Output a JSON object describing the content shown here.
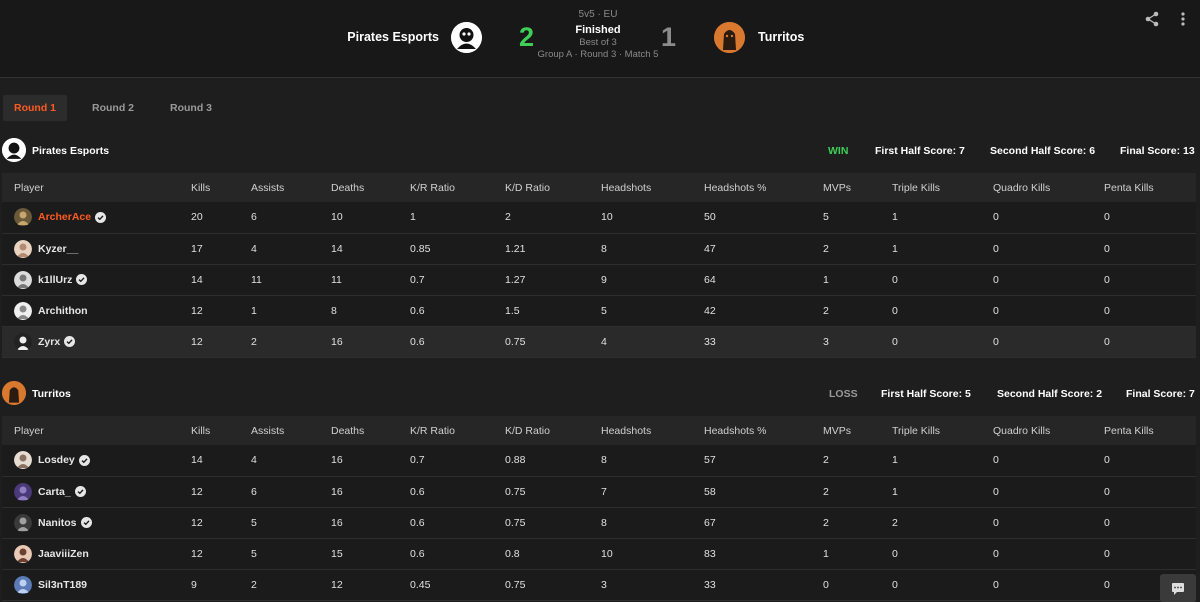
{
  "header": {
    "team_left": {
      "name": "Pirates Esports",
      "score": "2"
    },
    "team_right": {
      "name": "Turritos",
      "score": "1"
    },
    "mode": "5v5 · EU",
    "status": "Finished",
    "best_of": "Best of 3",
    "group_info": "Group A · Round 3 · Match 5"
  },
  "tabs": [
    "Round 1",
    "Round 2",
    "Round 3"
  ],
  "columns": [
    "Player",
    "Kills",
    "Assists",
    "Deaths",
    "K/R Ratio",
    "K/D Ratio",
    "Headshots",
    "Headshots %",
    "MVPs",
    "Triple Kills",
    "Quadro Kills",
    "Penta Kills"
  ],
  "team1": {
    "name": "Pirates Esports",
    "result": "WIN",
    "first_half": "First Half Score: 7",
    "second_half": "Second Half Score: 6",
    "final": "Final Score: 13",
    "players": [
      {
        "name": "ArcherAce",
        "verified": true,
        "stats": [
          "20",
          "6",
          "10",
          "1",
          "2",
          "10",
          "50",
          "5",
          "1",
          "0",
          "0"
        ]
      },
      {
        "name": "Kyzer__",
        "verified": false,
        "stats": [
          "17",
          "4",
          "14",
          "0.85",
          "1.21",
          "8",
          "47",
          "2",
          "1",
          "0",
          "0"
        ]
      },
      {
        "name": "k1llUrz",
        "verified": true,
        "stats": [
          "14",
          "11",
          "11",
          "0.7",
          "1.27",
          "9",
          "64",
          "1",
          "0",
          "0",
          "0"
        ]
      },
      {
        "name": "Archithon",
        "verified": false,
        "stats": [
          "12",
          "1",
          "8",
          "0.6",
          "1.5",
          "5",
          "42",
          "2",
          "0",
          "0",
          "0"
        ]
      },
      {
        "name": "Zyrx",
        "verified": true,
        "stats": [
          "12",
          "2",
          "16",
          "0.6",
          "0.75",
          "4",
          "33",
          "3",
          "0",
          "0",
          "0"
        ]
      }
    ]
  },
  "team2": {
    "name": "Turritos",
    "result": "LOSS",
    "first_half": "First Half Score: 5",
    "second_half": "Second Half Score: 2",
    "final": "Final Score: 7",
    "players": [
      {
        "name": "Losdey",
        "verified": true,
        "stats": [
          "14",
          "4",
          "16",
          "0.7",
          "0.88",
          "8",
          "57",
          "2",
          "1",
          "0",
          "0"
        ]
      },
      {
        "name": "Carta_",
        "verified": true,
        "stats": [
          "12",
          "6",
          "16",
          "0.6",
          "0.75",
          "7",
          "58",
          "2",
          "1",
          "0",
          "0"
        ]
      },
      {
        "name": "Nanitos",
        "verified": true,
        "stats": [
          "12",
          "5",
          "16",
          "0.6",
          "0.75",
          "8",
          "67",
          "2",
          "2",
          "0",
          "0"
        ]
      },
      {
        "name": "JaaviiiZen",
        "verified": false,
        "stats": [
          "12",
          "5",
          "15",
          "0.6",
          "0.8",
          "10",
          "83",
          "1",
          "0",
          "0",
          "0"
        ]
      },
      {
        "name": "Sil3nT189",
        "verified": false,
        "stats": [
          "9",
          "2",
          "12",
          "0.45",
          "0.75",
          "3",
          "33",
          "0",
          "0",
          "0",
          "0"
        ]
      }
    ]
  },
  "colors": {
    "accent": "#ff5a1f",
    "win": "#3fcf57",
    "loss": "#9a9a9a"
  }
}
